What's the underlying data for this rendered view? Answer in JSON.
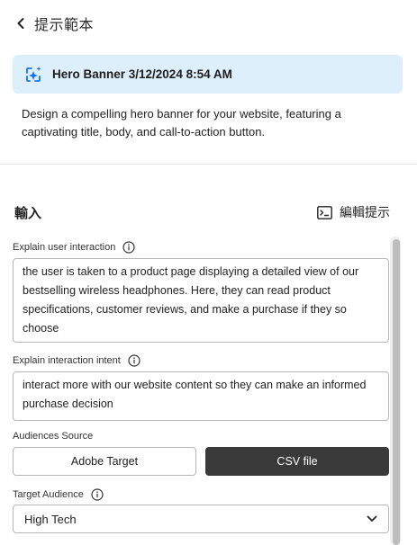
{
  "header": {
    "title": "提示範本"
  },
  "template": {
    "name": "Hero Banner 3/12/2024 8:54 AM",
    "description": "Design a compelling hero banner for your website, featuring a captivating title, body, and call-to-action button."
  },
  "input_section": {
    "title": "輸入",
    "edit_prompt_label": "編輯提示"
  },
  "fields": {
    "user_interaction": {
      "label": "Explain user interaction",
      "value": "the user is taken to a product page displaying a detailed view of our bestselling wireless headphones. Here, they can read product specifications, customer reviews, and make a purchase if they so choose"
    },
    "interaction_intent": {
      "label": "Explain interaction intent",
      "value": "interact more with our website content so they can make an informed purchase decision"
    },
    "audiences_source": {
      "label": "Audiences Source",
      "options": [
        "Adobe Target",
        "CSV file"
      ],
      "selected": "CSV file"
    },
    "target_audience": {
      "label": "Target Audience",
      "value": "High Tech"
    }
  },
  "colors": {
    "card_background": "#ddeffb",
    "button_selected": "#3a3a3a",
    "accent_blue": "#1473e6"
  },
  "icons": {
    "back": "chevron-left-icon",
    "template": "sparkle-frame-icon",
    "edit_prompt": "terminal-prompt-icon",
    "info": "info-icon",
    "dropdown": "chevron-down-icon"
  }
}
